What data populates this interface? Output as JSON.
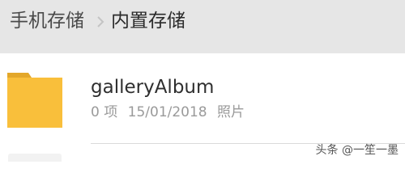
{
  "breadcrumb": {
    "root_label": "手机存储",
    "separator_icon": "chevron-right-icon",
    "current_label": "内置存储"
  },
  "files": [
    {
      "icon": "folder-icon",
      "name": "galleryAlbum",
      "item_count": "0 项",
      "date": "15/01/2018",
      "type": "照片"
    }
  ],
  "watermark": "头条 @一笙一墨",
  "colors": {
    "breadcrumb_bg": "#e6e6e6",
    "folder": "#f9bf3b",
    "folder_tab": "#e3a72a",
    "text_primary": "#2f2f2f",
    "text_secondary": "#9a9a9a"
  }
}
